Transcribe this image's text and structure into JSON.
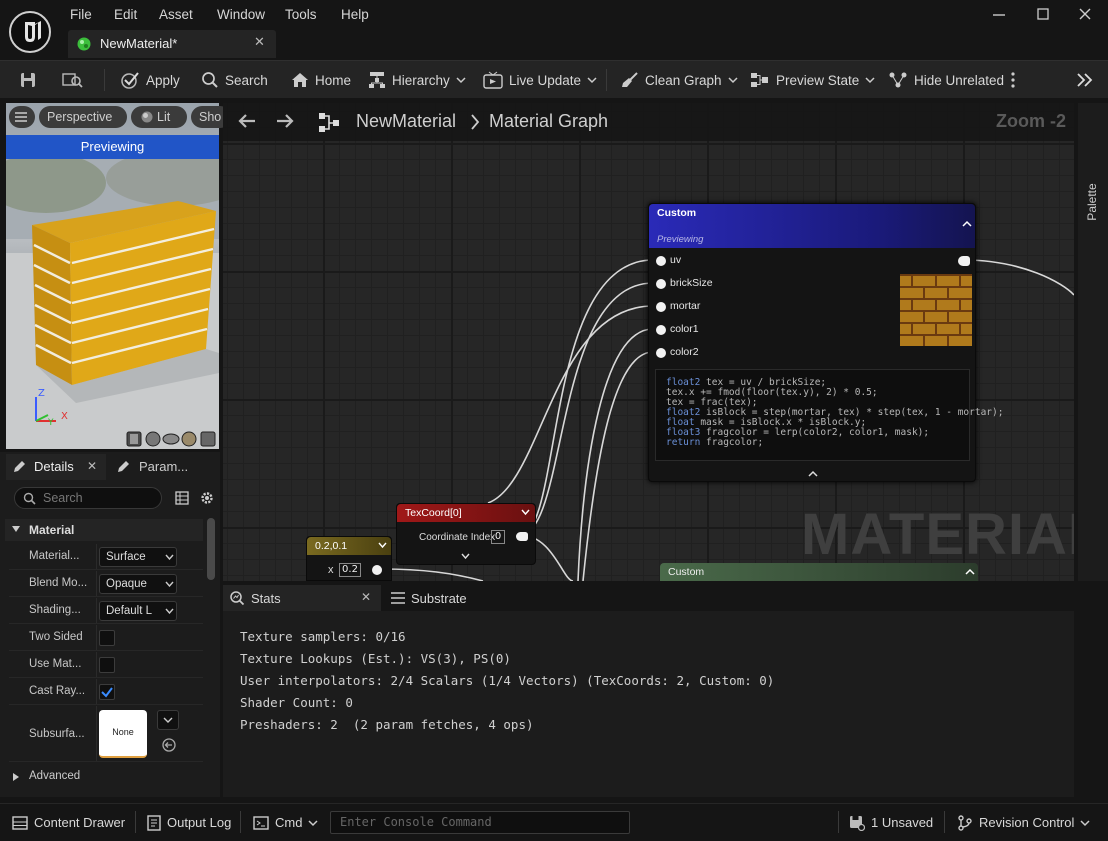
{
  "window": {
    "doc_tab": "NewMaterial*"
  },
  "menu": [
    "File",
    "Edit",
    "Asset",
    "Window",
    "Tools",
    "Help"
  ],
  "toolbar": {
    "apply": "Apply",
    "search": "Search",
    "home": "Home",
    "hierarchy": "Hierarchy",
    "live_update": "Live Update",
    "clean_graph": "Clean Graph",
    "preview_state": "Preview State",
    "hide_unrelated": "Hide Unrelated"
  },
  "viewport": {
    "perspective": "Perspective",
    "lit": "Lit",
    "show": "Sho",
    "previewing": "Previewing",
    "axis_z": "Z",
    "axis_x": "X",
    "axis_y": "Y"
  },
  "details": {
    "tab_details": "Details",
    "tab_params": "Param...",
    "search_placeholder": "Search",
    "section": "Material",
    "rows": [
      {
        "label": "Material...",
        "value": "Surface"
      },
      {
        "label": "Blend Mo...",
        "value": "Opaque"
      },
      {
        "label": "Shading...",
        "value": "Default L"
      },
      {
        "label": "Two Sided",
        "checked": false
      },
      {
        "label": "Use Mat...",
        "checked": false
      },
      {
        "label": "Cast Ray...",
        "checked": true
      },
      {
        "label": "Subsurfa...",
        "value": "None"
      }
    ],
    "advanced": "Advanced"
  },
  "graph": {
    "breadcrumb_root": "NewMaterial",
    "breadcrumb_current": "Material Graph",
    "zoom": "Zoom -2",
    "watermark": "MATERIAL",
    "palette": "Palette"
  },
  "custom_node": {
    "title": "Custom",
    "subtitle": "Previewing",
    "pins": [
      "uv",
      "brickSize",
      "mortar",
      "color1",
      "color2"
    ],
    "code": [
      [
        "float2",
        " tex = uv / brickSize;"
      ],
      [
        "",
        "tex.x += fmod(floor(tex.y), 2) * 0.5;"
      ],
      [
        "",
        "tex = frac(tex);"
      ],
      [
        "float2",
        " isBlock = step(mortar, tex) * step(tex, 1 - mortar);"
      ],
      [
        "float",
        " mask = isBlock.x * isBlock.y;"
      ],
      [
        "float3",
        " fragcolor = lerp(color2, color1, mask);"
      ],
      [
        "return",
        " fragcolor;"
      ]
    ]
  },
  "texcoord_node": {
    "title": "TexCoord[0]",
    "label": "Coordinate Index",
    "value": "0"
  },
  "const_node": {
    "title": "0.2,0.1",
    "label": "x",
    "value": "0.2"
  },
  "custom_node2": {
    "title": "Custom"
  },
  "bottom": {
    "tab_stats": "Stats",
    "tab_substrate": "Substrate",
    "stats": [
      "Texture samplers: 0/16",
      "Texture Lookups (Est.): VS(3), PS(0)",
      "User interpolators: 2/4 Scalars (1/4 Vectors) (TexCoords: 2, Custom: 0)",
      "Shader Count: 0",
      "Preshaders: 2  (2 param fetches, 4 ops)"
    ]
  },
  "statusbar": {
    "content_drawer": "Content Drawer",
    "output_log": "Output Log",
    "cmd": "Cmd",
    "console_placeholder": "Enter Console Command",
    "unsaved": "1 Unsaved",
    "revision_control": "Revision Control"
  }
}
